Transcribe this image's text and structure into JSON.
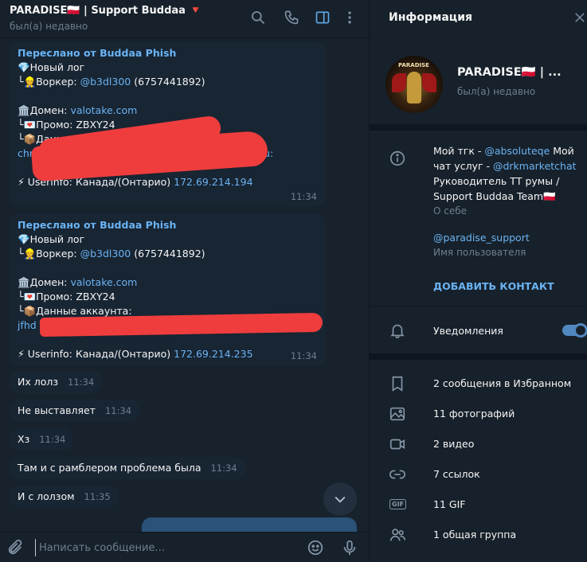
{
  "chat": {
    "title": "PARADISE🇵🇱 | Support Buddaa 🔻",
    "status": "был(а) недавно",
    "icons": [
      "search-icon",
      "phone-icon",
      "sidebar-toggle-icon",
      "more-icon"
    ]
  },
  "messages": [
    {
      "forwarded_from": "Переслано от Buddaa Phish",
      "new_log": "💎Новый лог",
      "worker_prefix": "└👷Воркер: ",
      "worker_handle": "@b3dl300",
      "worker_id": " (6757441892)",
      "domain_prefix": "🏛️Домен: ",
      "domain": "valotake.com",
      "promo": "└💌Промо: ZBXY24",
      "account_data": "└📦Данные аккаунта:",
      "account_partial_start": "christ",
      "account_partial_end": "ler.ru:",
      "userinfo_prefix": "⚡ Userinfo: Канада/(Онтарио) ",
      "ip": "172.69.214.194",
      "time": "11:34"
    },
    {
      "forwarded_from": "Переслано от Buddaa Phish",
      "new_log": "💎Новый лог",
      "worker_prefix": "└👷Воркер: ",
      "worker_handle": "@b3dl300",
      "worker_id": " (6757441892)",
      "domain_prefix": "🏛️Домен: ",
      "domain": "valotake.com",
      "promo": "└💌Промо: ZBXY24",
      "account_data": "└📦Данные аккаунта:",
      "account_partial_start": "jfhd",
      "account_partial_end": "",
      "userinfo_prefix": "⚡ Userinfo: Канада/(Онтарио) ",
      "ip": "172.69.214.235",
      "time": "11:34"
    }
  ],
  "short_messages": [
    {
      "text": "Их лолз",
      "time": "11:34"
    },
    {
      "text": "Не выставляет",
      "time": "11:34"
    },
    {
      "text": "Хз",
      "time": "11:34"
    },
    {
      "text": "Там и с рамблером проблема была",
      "time": "11:34"
    },
    {
      "text": "И с лолзом",
      "time": "11:35"
    }
  ],
  "composer": {
    "placeholder": "Написать сообщение..."
  },
  "info": {
    "title": "Информация",
    "avatar_text": "PARADISE",
    "name": "PARADISE🇵🇱 | ...",
    "status": "был(а) недавно",
    "bio_prefix_1": "Мой тгк - ",
    "bio_link_1": "@absoluteqe",
    "bio_mid": " Мой чат услуг - ",
    "bio_link_2": "@drkmarketchat",
    "bio_suffix": " Руководитель ТТ румы / Support Buddaa Team🇵🇱",
    "bio_label": "О себе",
    "username": "@paradise_support",
    "username_label": "Имя пользователя",
    "add_contact": "ДОБАВИТЬ КОНТАКТ",
    "notifications": "Уведомления",
    "notifications_on": true,
    "media": [
      {
        "icon": "bookmark-icon",
        "label": "2 сообщения в Избранном"
      },
      {
        "icon": "photo-icon",
        "label": "11 фотографий"
      },
      {
        "icon": "video-icon",
        "label": "2 видео"
      },
      {
        "icon": "link-icon",
        "label": "7 ссылок"
      },
      {
        "icon": "gif-icon",
        "label": "11 GIF"
      },
      {
        "icon": "group-icon",
        "label": "1 общая группа"
      }
    ]
  },
  "colors": {
    "accent": "#6ab3f3",
    "toggle": "#5288c1",
    "redaction": "#ef3d3d"
  }
}
